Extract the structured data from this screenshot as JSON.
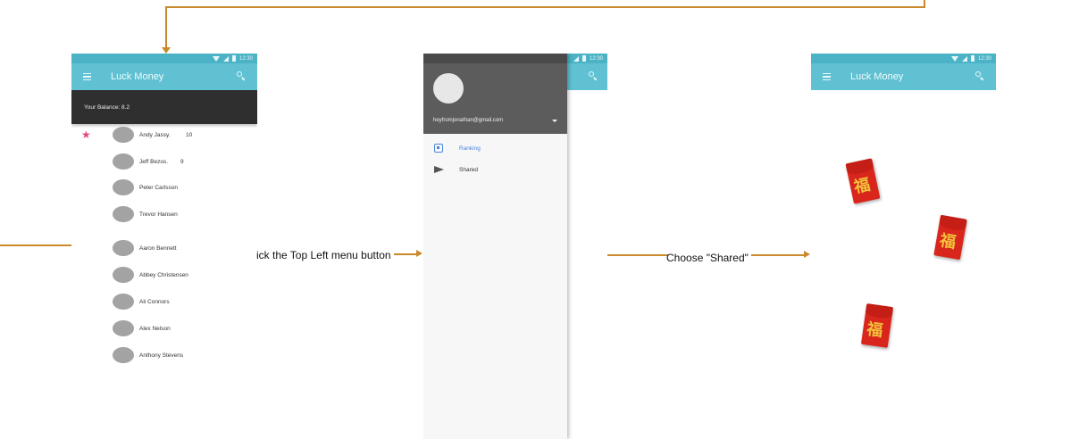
{
  "colors": {
    "toolbar": "#5fc1d2",
    "statusbar": "#4bb3c5",
    "balance_bar": "#2f2f2f",
    "connector": "#c98a2c",
    "star": "#e0497d",
    "envelope": "#d9261c"
  },
  "status_time": "12:30",
  "screen1": {
    "title": "Luck Money",
    "balance": "Your Balance: 8.2",
    "rows": [
      {
        "name": "Andy Jassy.",
        "score": "10",
        "starred": true
      },
      {
        "name": "Jeff Bezos.",
        "score": "9",
        "starred": false
      },
      {
        "name": "Peter Carlsson",
        "score": "",
        "starred": false
      },
      {
        "name": "Trevor Hansen",
        "score": "",
        "starred": false
      },
      {
        "name": "Aaron Bennett",
        "score": "",
        "starred": false
      },
      {
        "name": "Abbey Christensen",
        "score": "",
        "starred": false
      },
      {
        "name": "Ali Connors",
        "score": "",
        "starred": false
      },
      {
        "name": "Alex Nelson",
        "score": "",
        "starred": false
      },
      {
        "name": "Anthony Stevens",
        "score": "",
        "starred": false
      }
    ]
  },
  "screen2": {
    "email": "heyfromjonathan@gmail.com",
    "items": [
      {
        "label": "Ranking",
        "icon": "ranking-icon",
        "active": true
      },
      {
        "label": "Shared",
        "icon": "send-icon",
        "active": false
      }
    ]
  },
  "screen3": {
    "title": "Luck Money",
    "envelope_char": "福"
  },
  "flow": {
    "step1": "ick the Top Left menu button",
    "step2": "Choose \"Shared\""
  }
}
